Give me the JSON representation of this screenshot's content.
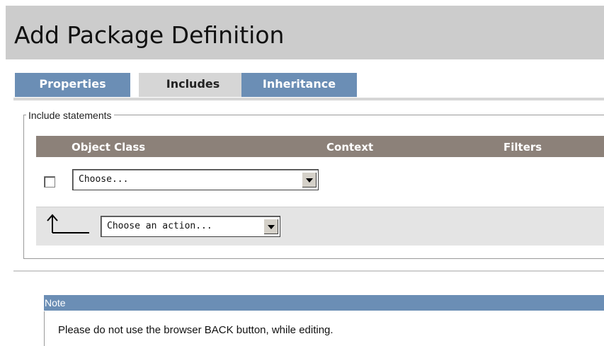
{
  "page": {
    "title": "Add Package Definition"
  },
  "tabs": [
    {
      "label": "Properties",
      "active": false
    },
    {
      "label": "Includes",
      "active": true
    },
    {
      "label": "Inheritance",
      "active": false
    }
  ],
  "includes": {
    "legend": "Include statements",
    "columns": [
      "Object Class",
      "Context",
      "Filters"
    ],
    "row": {
      "checked": false,
      "object_class_value": "Choose..."
    },
    "action_select_value": "Choose an action..."
  },
  "note": {
    "title": "Note",
    "text": "Please do not use the browser BACK button, while editing."
  },
  "colors": {
    "header_bg": "#cccccc",
    "tab_inactive": "#6b8eb5",
    "tab_active": "#d6d6d6",
    "grid_header": "#8c8179",
    "note_header": "#6b8eb5"
  },
  "icons": {
    "action_arrow": "up-arrow-icon",
    "dropdown": "chevron-down-icon"
  }
}
